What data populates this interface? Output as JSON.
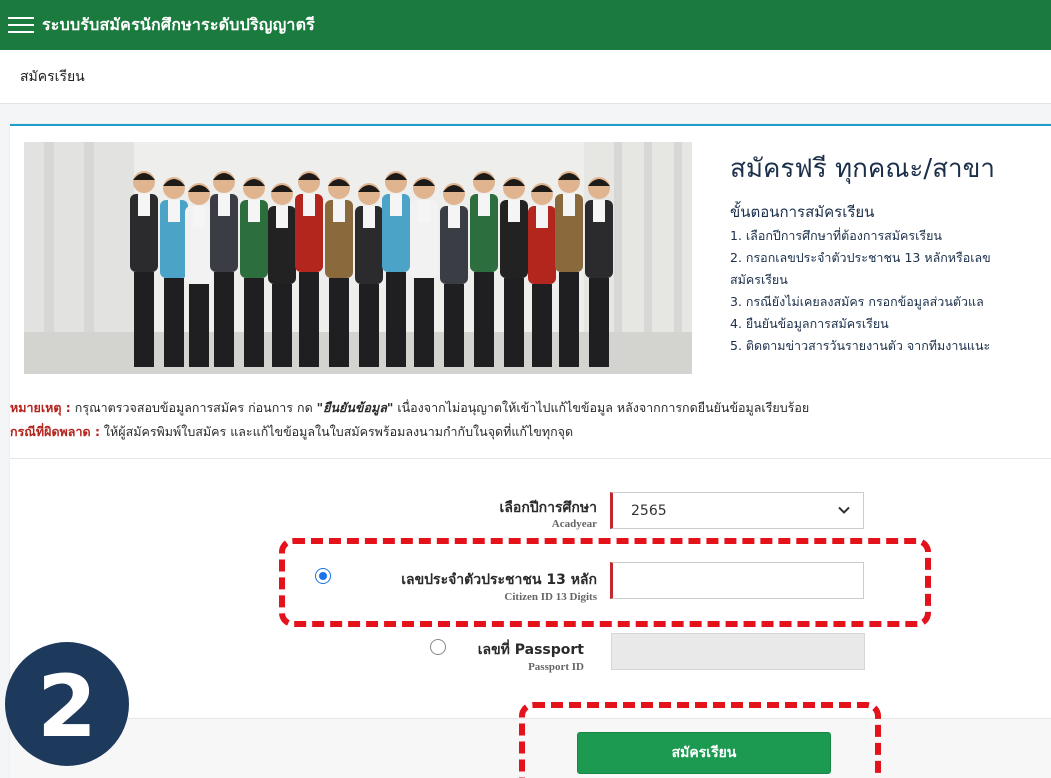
{
  "header": {
    "app_title": "ระบบรับสมัครนักศึกษาระดับปริญญาตรี",
    "menu_icon": "hamburger-menu-icon",
    "bar_color": "#1b7a3e"
  },
  "breadcrumb": {
    "label": "สมัครเรียน"
  },
  "promo": {
    "title": "สมัครฟรี ทุกคณะ/สาขา",
    "steps_heading": "ขั้นตอนการสมัครเรียน",
    "steps": [
      "1. เลือกปีการศึกษาที่ต้องการสมัครเรียน",
      "2. กรอกเลขประจำตัวประชาชน 13 หลักหรือเลข",
      "สมัครเรียน",
      "3. กรณียังไม่เคยลงสมัคร กรอกข้อมูลส่วนตัวแล",
      "4. ยืนยันข้อมูลการสมัครเรียน",
      "5. ติดตามข่าวสารวันรายงานตัว จากทีมงานแนะ"
    ]
  },
  "notes": {
    "note1_label": "หมายเหตุ :",
    "note1_text_a": " กรุณาตรวจสอบข้อมูลการสมัคร ก่อนการ กด ",
    "note1_emphasis": "\"ยืนยันข้อมูล\"",
    "note1_text_b": " เนื่องจากไม่อนุญาตให้เข้าไปแก้ไขข้อมูล หลังจากการกดยืนยันข้อมูลเรียบร้อย",
    "note2_label": "กรณีที่ผิดพลาด :",
    "note2_text": " ให้ผู้สมัครพิมพ์ใบสมัคร และแก้ไขข้อมูลในใบสมัครพร้อมลงนามกำกับในจุดที่แก้ไขทุกจุด"
  },
  "form": {
    "year_label": "เลือกปีการศึกษา",
    "year_sub": "Acadyear",
    "year_value": "2565",
    "citizen_label": "เลขประจำตัวประชาชน 13 หลัก",
    "citizen_sub": "Citizen ID 13 Digits",
    "citizen_value": "",
    "citizen_selected": true,
    "passport_label": "เลขที่ Passport",
    "passport_sub": "Passport ID",
    "passport_value": "",
    "passport_selected": false,
    "submit_label": "สมัครเรียน"
  },
  "overlay": {
    "step_number": "2",
    "highlight_color": "#e4121b",
    "badge_color": "#1d3a5c"
  },
  "colors": {
    "accent_green": "#1c9a52",
    "card_border": "#1d9fc9",
    "required_marker": "#c0282d"
  }
}
